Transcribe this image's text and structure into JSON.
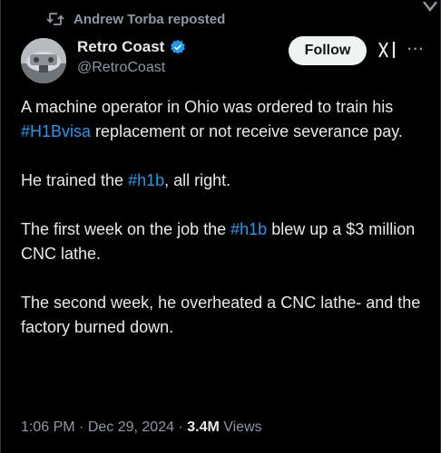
{
  "repost": {
    "label": "Andrew Torba reposted"
  },
  "author": {
    "display_name": "Retro Coast",
    "handle": "@RetroCoast",
    "verified": true,
    "verified_color": "#1d9bf0"
  },
  "follow_label": "Follow",
  "more_label": "···",
  "tweet": {
    "paragraphs": [
      {
        "parts": [
          {
            "t": "A machine operator in Ohio was ordered to train his "
          },
          {
            "t": "#H1Bvisa",
            "tag": true
          },
          {
            "t": " replacement or not receive severance pay."
          }
        ]
      },
      {
        "parts": [
          {
            "t": "He trained the "
          },
          {
            "t": "#h1b",
            "tag": true
          },
          {
            "t": ", all right."
          }
        ]
      },
      {
        "parts": [
          {
            "t": "The first week on the job the "
          },
          {
            "t": "#h1b",
            "tag": true
          },
          {
            "t": " blew up a $3 million CNC lathe."
          }
        ]
      },
      {
        "parts": [
          {
            "t": "The second week, he overheated a CNC lathe- and the factory burned down."
          }
        ]
      }
    ]
  },
  "meta": {
    "time": "1:06 PM",
    "sep1": " · ",
    "date": "Dec 29, 2024",
    "sep2": " · ",
    "views_count": "3.4M",
    "views_label": " Views"
  },
  "colors": {
    "background": "#000000",
    "text": "#e7e9ea",
    "secondary": "#8b98a5",
    "link": "#1d9bf0"
  },
  "icons": {
    "repost": "repost-icon",
    "verified": "verified-badge-icon",
    "grok": "grok-icon",
    "more": "more-icon"
  }
}
